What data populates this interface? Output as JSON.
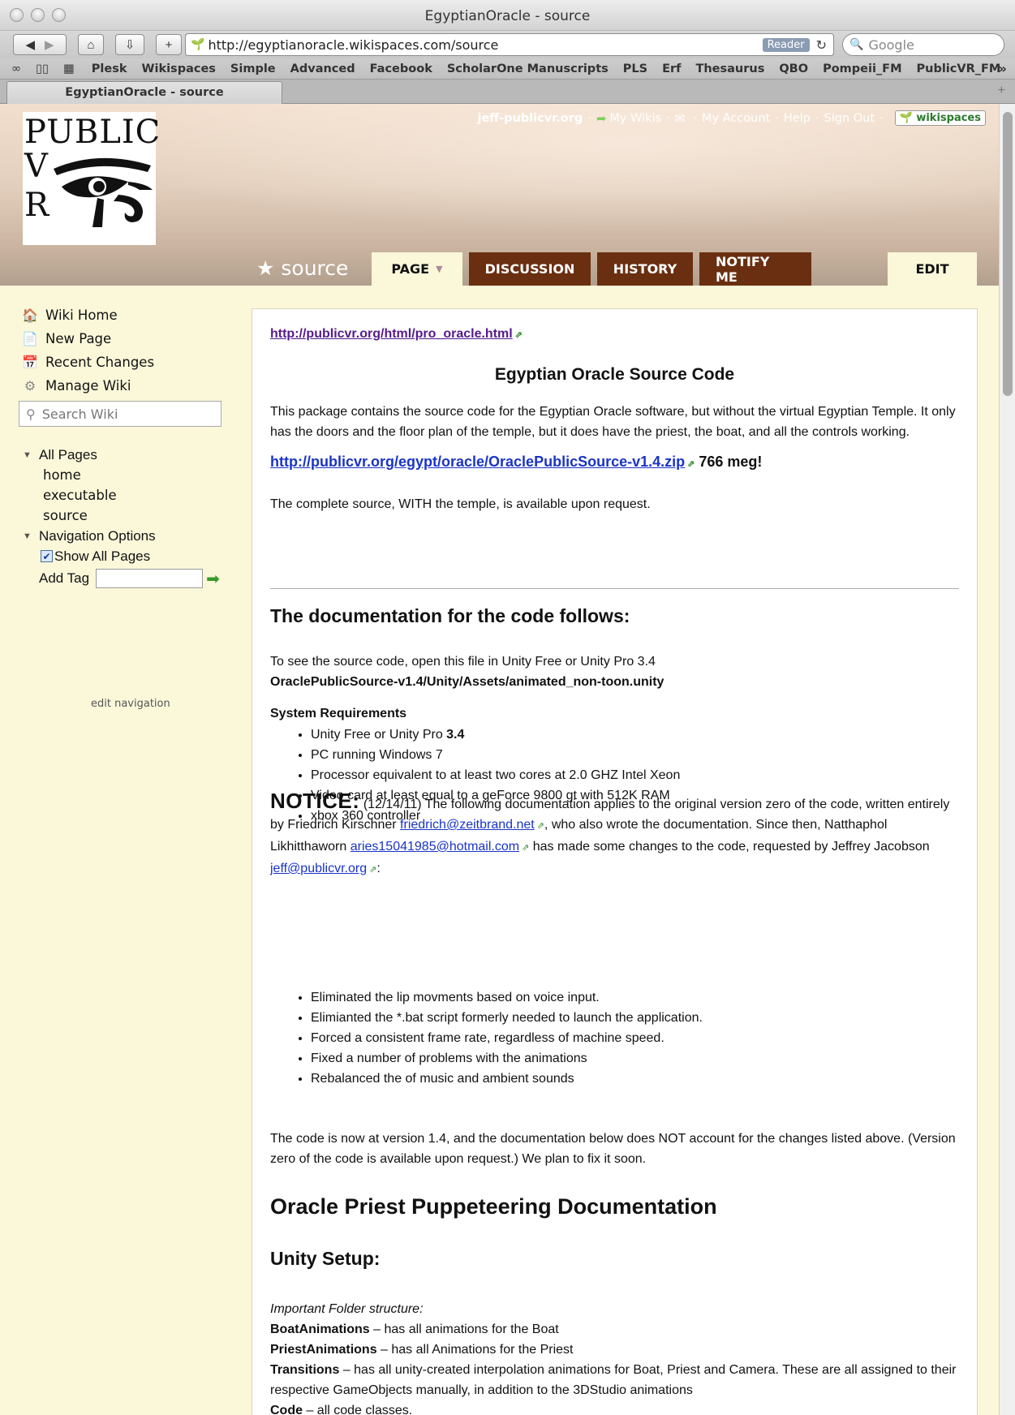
{
  "window": {
    "title": "EgyptianOracle - source"
  },
  "toolbar": {
    "url": "http://egyptianoracle.wikispaces.com/source",
    "reader_label": "Reader",
    "search_placeholder": "Google"
  },
  "bookmarks": [
    "Plesk",
    "Wikispaces",
    "Simple",
    "Advanced",
    "Facebook",
    "ScholarOne Manuscripts",
    "PLS",
    "Erf",
    "Thesaurus",
    "QBO",
    "Pompeii_FM",
    "PublicVR_FM"
  ],
  "tab": {
    "label": "EgyptianOracle - source"
  },
  "header": {
    "logo_line1": "PUBLIC",
    "logo_v": "V",
    "logo_r": "R",
    "user": "jeff-publicvr.org",
    "links": [
      "My Wikis",
      "My Account",
      "Help",
      "Sign Out"
    ],
    "badge": "wikispaces",
    "page_name": "source",
    "tabs": {
      "page": "PAGE",
      "discussion": "DISCUSSION",
      "history": "HISTORY",
      "notify": "NOTIFY ME",
      "edit": "EDIT"
    }
  },
  "sidebar": {
    "nav": [
      "Wiki Home",
      "New Page",
      "Recent Changes",
      "Manage Wiki"
    ],
    "search_placeholder": "Search Wiki",
    "all_pages": "All Pages",
    "pages": [
      "home",
      "executable",
      "source"
    ],
    "nav_options": "Navigation Options",
    "show_all": "Show All Pages",
    "add_tag": "Add Tag",
    "edit_nav": "edit navigation"
  },
  "content": {
    "top_link": "http://publicvr.org/html/pro_oracle.html",
    "title": "Egyptian Oracle Source Code",
    "intro": "This package contains the source code for the Egyptian Oracle software, but without the virtual Egyptian Temple. It only has the doors and the floor plan of the temple, but it does have the priest, the boat, and all the controls working.",
    "zip_link": "http://publicvr.org/egypt/oracle/OraclePublicSource-v1.4.zip",
    "zip_size": "766 meg!",
    "complete": "The complete source, WITH the temple, is available upon request.",
    "doc_heading": "The documentation for the code follows:",
    "open_text": "To see the source code, open this file in Unity Free or Unity Pro 3.4",
    "open_path": "OraclePublicSource-v1.4/Unity/Assets/animated_non-toon.unity",
    "sysreq_heading": "System Requirements",
    "req_1a": "Unity Free or Unity Pro ",
    "req_1b": "3.4",
    "req_2": "PC running Windows 7",
    "req_3": "Processor equivalent to at least two cores at 2.0 GHZ Intel Xeon",
    "req_4": "Video card at least equal to a geForce 9800 gt with 512K RAM",
    "req_5": "xbox 360 controller",
    "notice_label": "NOTICE:",
    "notice_1": " (12/14/11) The following documentation applies to the original version zero of the code, written entirely by Friedrich Kirschner ",
    "notice_email1": "friedrich@zeitbrand.net",
    "notice_2": ", who also wrote the documentation. Since then, Natthaphol Likhitthaworn ",
    "notice_email2": "aries15041985@hotmail.com",
    "notice_3": " has made some changes to the code, requested by Jeffrey Jacobson ",
    "notice_email3": "jeff@publicvr.org",
    "notice_4": ":",
    "change_1": "Eliminated the lip movments based on voice input.",
    "change_2": "Elimianted the *.bat script formerly needed to launch the application.",
    "change_3": "Forced a consistent frame rate, regardless of machine speed.",
    "change_4": "Fixed a number of problems with the animations",
    "change_5": "Rebalanced the of music and ambient sounds",
    "version": "The code is now at version 1.4, and the documentation below does NOT account for the changes listed above. (Version zero of the code is available upon request.) We plan to fix it soon.",
    "priest_heading": "Oracle Priest Puppeteering Documentation",
    "unity_heading": "Unity Setup:",
    "folders_intro": "Important Folder structure:",
    "boat_label": "BoatAnimations",
    "boat_text": " – has all animations for the Boat",
    "priest_label": "PriestAnimations",
    "priest_text": " – has all Animations for the Priest",
    "trans_label": "Transitions",
    "trans_text": " – has all unity-created interpolation animations for Boat, Priest and Camera. These are all assigned to their respective GameObjects manually, in addition to the 3DStudio animations",
    "code_label": "Code",
    "code_text": " – all code classes."
  }
}
